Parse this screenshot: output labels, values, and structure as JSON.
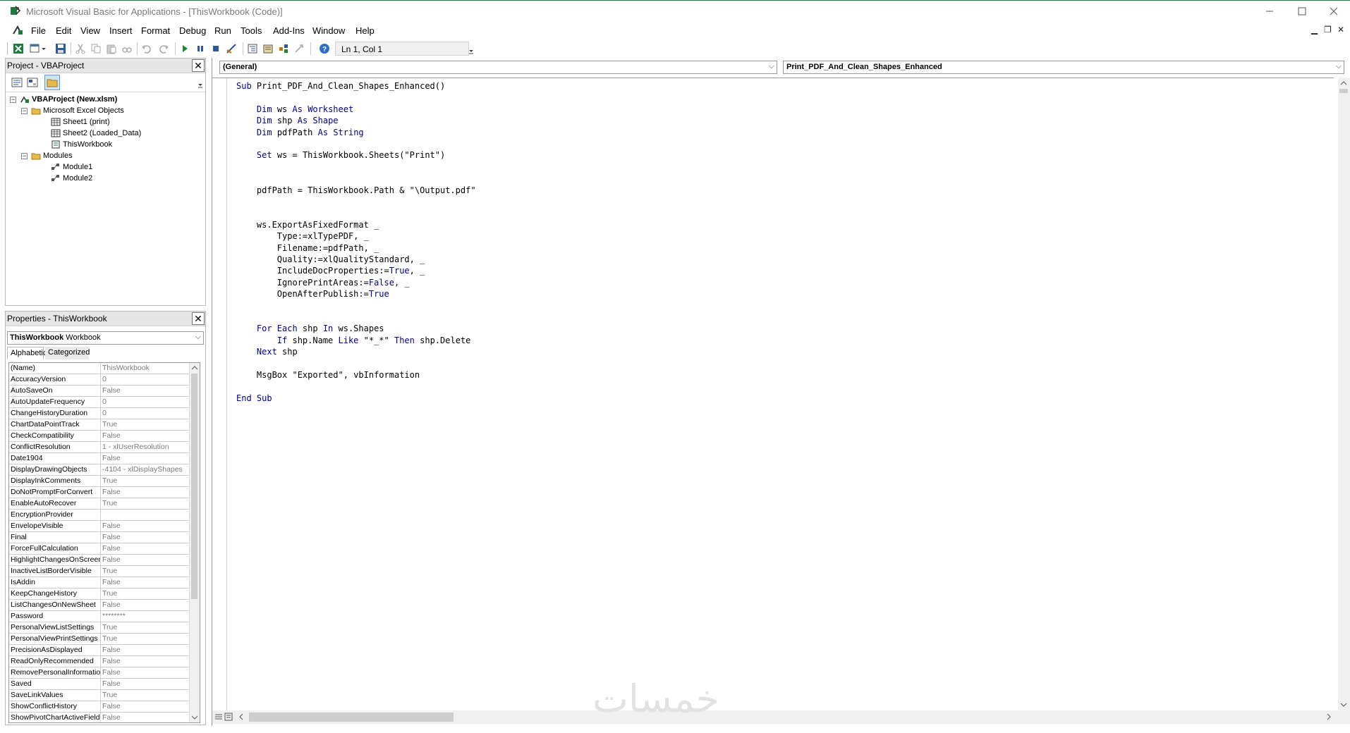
{
  "window": {
    "title": "Microsoft Visual Basic for Applications - [ThisWorkbook (Code)]"
  },
  "menu": [
    "File",
    "Edit",
    "View",
    "Insert",
    "Format",
    "Debug",
    "Run",
    "Tools",
    "Add-Ins",
    "Window",
    "Help"
  ],
  "toolbar": {
    "position": "Ln 1, Col 1"
  },
  "project_pane": {
    "title": "Project - VBAProject",
    "tree": [
      {
        "label": "VBAProject (New.xlsm)",
        "icon": "vbaproject-icon"
      },
      {
        "label": "Microsoft Excel Objects",
        "icon": "folder-icon"
      },
      {
        "label": "Sheet1 (print)",
        "icon": "sheet-icon"
      },
      {
        "label": "Sheet2 (Loaded_Data)",
        "icon": "sheet-icon"
      },
      {
        "label": "ThisWorkbook",
        "icon": "workbook-icon"
      },
      {
        "label": "Modules",
        "icon": "folder-icon"
      },
      {
        "label": "Module1",
        "icon": "module-icon"
      },
      {
        "label": "Module2",
        "icon": "module-icon"
      }
    ]
  },
  "properties_pane": {
    "title": "Properties - ThisWorkbook",
    "object_name": "ThisWorkbook",
    "object_type": "Workbook",
    "tabs": [
      "Alphabetic",
      "Categorized"
    ],
    "rows": [
      {
        "name": "(Name)",
        "value": "ThisWorkbook"
      },
      {
        "name": "AccuracyVersion",
        "value": "0"
      },
      {
        "name": "AutoSaveOn",
        "value": "False"
      },
      {
        "name": "AutoUpdateFrequency",
        "value": "0"
      },
      {
        "name": "ChangeHistoryDuration",
        "value": "0"
      },
      {
        "name": "ChartDataPointTrack",
        "value": "True"
      },
      {
        "name": "CheckCompatibility",
        "value": "False"
      },
      {
        "name": "ConflictResolution",
        "value": "1 - xlUserResolution"
      },
      {
        "name": "Date1904",
        "value": "False"
      },
      {
        "name": "DisplayDrawingObjects",
        "value": "-4104 - xlDisplayShapes"
      },
      {
        "name": "DisplayInkComments",
        "value": "True"
      },
      {
        "name": "DoNotPromptForConvert",
        "value": "False"
      },
      {
        "name": "EnableAutoRecover",
        "value": "True"
      },
      {
        "name": "EncryptionProvider",
        "value": ""
      },
      {
        "name": "EnvelopeVisible",
        "value": "False"
      },
      {
        "name": "Final",
        "value": "False"
      },
      {
        "name": "ForceFullCalculation",
        "value": "False"
      },
      {
        "name": "HighlightChangesOnScreen",
        "value": "False"
      },
      {
        "name": "InactiveListBorderVisible",
        "value": "True"
      },
      {
        "name": "IsAddin",
        "value": "False"
      },
      {
        "name": "KeepChangeHistory",
        "value": "True"
      },
      {
        "name": "ListChangesOnNewSheet",
        "value": "False"
      },
      {
        "name": "Password",
        "value": "********"
      },
      {
        "name": "PersonalViewListSettings",
        "value": "True"
      },
      {
        "name": "PersonalViewPrintSettings",
        "value": "True"
      },
      {
        "name": "PrecisionAsDisplayed",
        "value": "False"
      },
      {
        "name": "ReadOnlyRecommended",
        "value": "False"
      },
      {
        "name": "RemovePersonalInformatio",
        "value": "False"
      },
      {
        "name": "Saved",
        "value": "False"
      },
      {
        "name": "SaveLinkValues",
        "value": "True"
      },
      {
        "name": "ShowConflictHistory",
        "value": "False"
      },
      {
        "name": "ShowPivotChartActiveField",
        "value": "False"
      }
    ]
  },
  "code_window": {
    "object_combo": "(General)",
    "procedure_combo": "Print_PDF_And_Clean_Shapes_Enhanced",
    "lines": [
      "Sub Print_PDF_And_Clean_Shapes_Enhanced()",
      "",
      "    Dim ws As Worksheet",
      "    Dim shp As Shape",
      "    Dim pdfPath As String",
      "",
      "    Set ws = ThisWorkbook.Sheets(\"Print\")",
      "",
      "",
      "    pdfPath = ThisWorkbook.Path & \"\\Output.pdf\"",
      "",
      "",
      "    ws.ExportAsFixedFormat _",
      "        Type:=xlTypePDF, _",
      "        Filename:=pdfPath, _",
      "        Quality:=xlQualityStandard, _",
      "        IncludeDocProperties:=True, _",
      "        IgnorePrintAreas:=False, _",
      "        OpenAfterPublish:=True",
      "",
      "",
      "    For Each shp In ws.Shapes",
      "        If shp.Name Like \"*_*\" Then shp.Delete",
      "    Next shp",
      "",
      "    MsgBox \"Exported\", vbInformation",
      "",
      "End Sub"
    ]
  },
  "watermark": "خمسات",
  "colors": {
    "keyword": "#00008b",
    "titlebar_border": "#1e7a3a",
    "pane_header": "#e6e6e6"
  }
}
